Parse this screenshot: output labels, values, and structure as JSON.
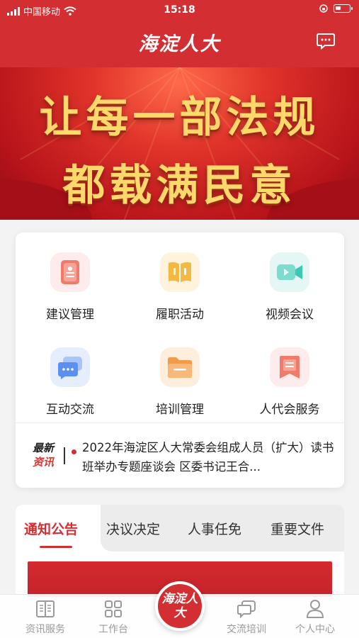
{
  "status_bar": {
    "carrier": "中国移动",
    "time": "15:18"
  },
  "header": {
    "title": "海淀人大",
    "icons": {
      "message": "chat-bubble-icon"
    }
  },
  "banner": {
    "line1": "让每一部法规",
    "line2": "都载满民意"
  },
  "features": [
    {
      "label": "建议管理",
      "icon": "document-seal-icon",
      "color": "#f07a6b"
    },
    {
      "label": "履职活动",
      "icon": "open-book-icon",
      "color": "#f5b942"
    },
    {
      "label": "视频会议",
      "icon": "video-camera-icon",
      "color": "#3ec7b4"
    },
    {
      "label": "互动交流",
      "icon": "chat-dots-icon",
      "color": "#5b8ff0"
    },
    {
      "label": "培训管理",
      "icon": "folder-icon",
      "color": "#f29b4a"
    },
    {
      "label": "人代会服务",
      "icon": "bookmark-document-icon",
      "color": "#f07a6b"
    }
  ],
  "news": {
    "tag_line1": "最新",
    "tag_line2": "资讯",
    "headline": "2022年海淀区人大常委会组成人员（扩大）读书班举办专题座谈会 区委书记王合..."
  },
  "tabs": [
    {
      "label": "通知公告",
      "active": true
    },
    {
      "label": "决议决定",
      "active": false
    },
    {
      "label": "人事任免",
      "active": false
    },
    {
      "label": "重要文件",
      "active": false
    }
  ],
  "tabbar": {
    "items": [
      {
        "label": "资讯服务",
        "icon": "book-icon"
      },
      {
        "label": "工作台",
        "icon": "grid-icon"
      },
      {
        "label": "交流培训",
        "icon": "chat-icon"
      },
      {
        "label": "个人中心",
        "icon": "person-icon"
      }
    ],
    "center_logo": "海淀人大"
  },
  "colors": {
    "brand_red": "#d32f33",
    "banner_gold": "#ffd86b"
  }
}
